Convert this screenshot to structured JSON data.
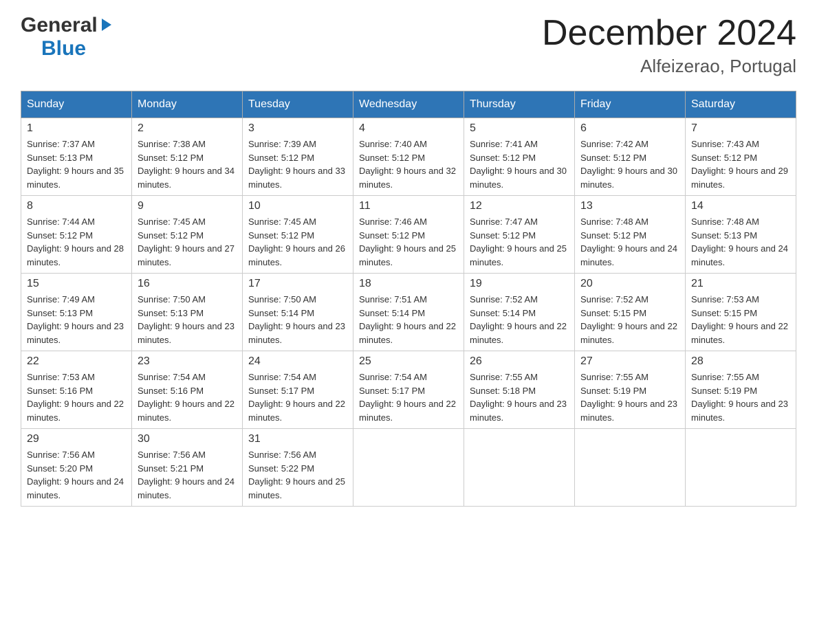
{
  "header": {
    "title": "December 2024",
    "subtitle": "Alfeizerao, Portugal"
  },
  "logo": {
    "general": "General",
    "blue": "Blue"
  },
  "days_of_week": [
    "Sunday",
    "Monday",
    "Tuesday",
    "Wednesday",
    "Thursday",
    "Friday",
    "Saturday"
  ],
  "weeks": [
    [
      {
        "day": "1",
        "sunrise": "7:37 AM",
        "sunset": "5:13 PM",
        "daylight": "9 hours and 35 minutes."
      },
      {
        "day": "2",
        "sunrise": "7:38 AM",
        "sunset": "5:12 PM",
        "daylight": "9 hours and 34 minutes."
      },
      {
        "day": "3",
        "sunrise": "7:39 AM",
        "sunset": "5:12 PM",
        "daylight": "9 hours and 33 minutes."
      },
      {
        "day": "4",
        "sunrise": "7:40 AM",
        "sunset": "5:12 PM",
        "daylight": "9 hours and 32 minutes."
      },
      {
        "day": "5",
        "sunrise": "7:41 AM",
        "sunset": "5:12 PM",
        "daylight": "9 hours and 30 minutes."
      },
      {
        "day": "6",
        "sunrise": "7:42 AM",
        "sunset": "5:12 PM",
        "daylight": "9 hours and 30 minutes."
      },
      {
        "day": "7",
        "sunrise": "7:43 AM",
        "sunset": "5:12 PM",
        "daylight": "9 hours and 29 minutes."
      }
    ],
    [
      {
        "day": "8",
        "sunrise": "7:44 AM",
        "sunset": "5:12 PM",
        "daylight": "9 hours and 28 minutes."
      },
      {
        "day": "9",
        "sunrise": "7:45 AM",
        "sunset": "5:12 PM",
        "daylight": "9 hours and 27 minutes."
      },
      {
        "day": "10",
        "sunrise": "7:45 AM",
        "sunset": "5:12 PM",
        "daylight": "9 hours and 26 minutes."
      },
      {
        "day": "11",
        "sunrise": "7:46 AM",
        "sunset": "5:12 PM",
        "daylight": "9 hours and 25 minutes."
      },
      {
        "day": "12",
        "sunrise": "7:47 AM",
        "sunset": "5:12 PM",
        "daylight": "9 hours and 25 minutes."
      },
      {
        "day": "13",
        "sunrise": "7:48 AM",
        "sunset": "5:12 PM",
        "daylight": "9 hours and 24 minutes."
      },
      {
        "day": "14",
        "sunrise": "7:48 AM",
        "sunset": "5:13 PM",
        "daylight": "9 hours and 24 minutes."
      }
    ],
    [
      {
        "day": "15",
        "sunrise": "7:49 AM",
        "sunset": "5:13 PM",
        "daylight": "9 hours and 23 minutes."
      },
      {
        "day": "16",
        "sunrise": "7:50 AM",
        "sunset": "5:13 PM",
        "daylight": "9 hours and 23 minutes."
      },
      {
        "day": "17",
        "sunrise": "7:50 AM",
        "sunset": "5:14 PM",
        "daylight": "9 hours and 23 minutes."
      },
      {
        "day": "18",
        "sunrise": "7:51 AM",
        "sunset": "5:14 PM",
        "daylight": "9 hours and 22 minutes."
      },
      {
        "day": "19",
        "sunrise": "7:52 AM",
        "sunset": "5:14 PM",
        "daylight": "9 hours and 22 minutes."
      },
      {
        "day": "20",
        "sunrise": "7:52 AM",
        "sunset": "5:15 PM",
        "daylight": "9 hours and 22 minutes."
      },
      {
        "day": "21",
        "sunrise": "7:53 AM",
        "sunset": "5:15 PM",
        "daylight": "9 hours and 22 minutes."
      }
    ],
    [
      {
        "day": "22",
        "sunrise": "7:53 AM",
        "sunset": "5:16 PM",
        "daylight": "9 hours and 22 minutes."
      },
      {
        "day": "23",
        "sunrise": "7:54 AM",
        "sunset": "5:16 PM",
        "daylight": "9 hours and 22 minutes."
      },
      {
        "day": "24",
        "sunrise": "7:54 AM",
        "sunset": "5:17 PM",
        "daylight": "9 hours and 22 minutes."
      },
      {
        "day": "25",
        "sunrise": "7:54 AM",
        "sunset": "5:17 PM",
        "daylight": "9 hours and 22 minutes."
      },
      {
        "day": "26",
        "sunrise": "7:55 AM",
        "sunset": "5:18 PM",
        "daylight": "9 hours and 23 minutes."
      },
      {
        "day": "27",
        "sunrise": "7:55 AM",
        "sunset": "5:19 PM",
        "daylight": "9 hours and 23 minutes."
      },
      {
        "day": "28",
        "sunrise": "7:55 AM",
        "sunset": "5:19 PM",
        "daylight": "9 hours and 23 minutes."
      }
    ],
    [
      {
        "day": "29",
        "sunrise": "7:56 AM",
        "sunset": "5:20 PM",
        "daylight": "9 hours and 24 minutes."
      },
      {
        "day": "30",
        "sunrise": "7:56 AM",
        "sunset": "5:21 PM",
        "daylight": "9 hours and 24 minutes."
      },
      {
        "day": "31",
        "sunrise": "7:56 AM",
        "sunset": "5:22 PM",
        "daylight": "9 hours and 25 minutes."
      },
      null,
      null,
      null,
      null
    ]
  ]
}
